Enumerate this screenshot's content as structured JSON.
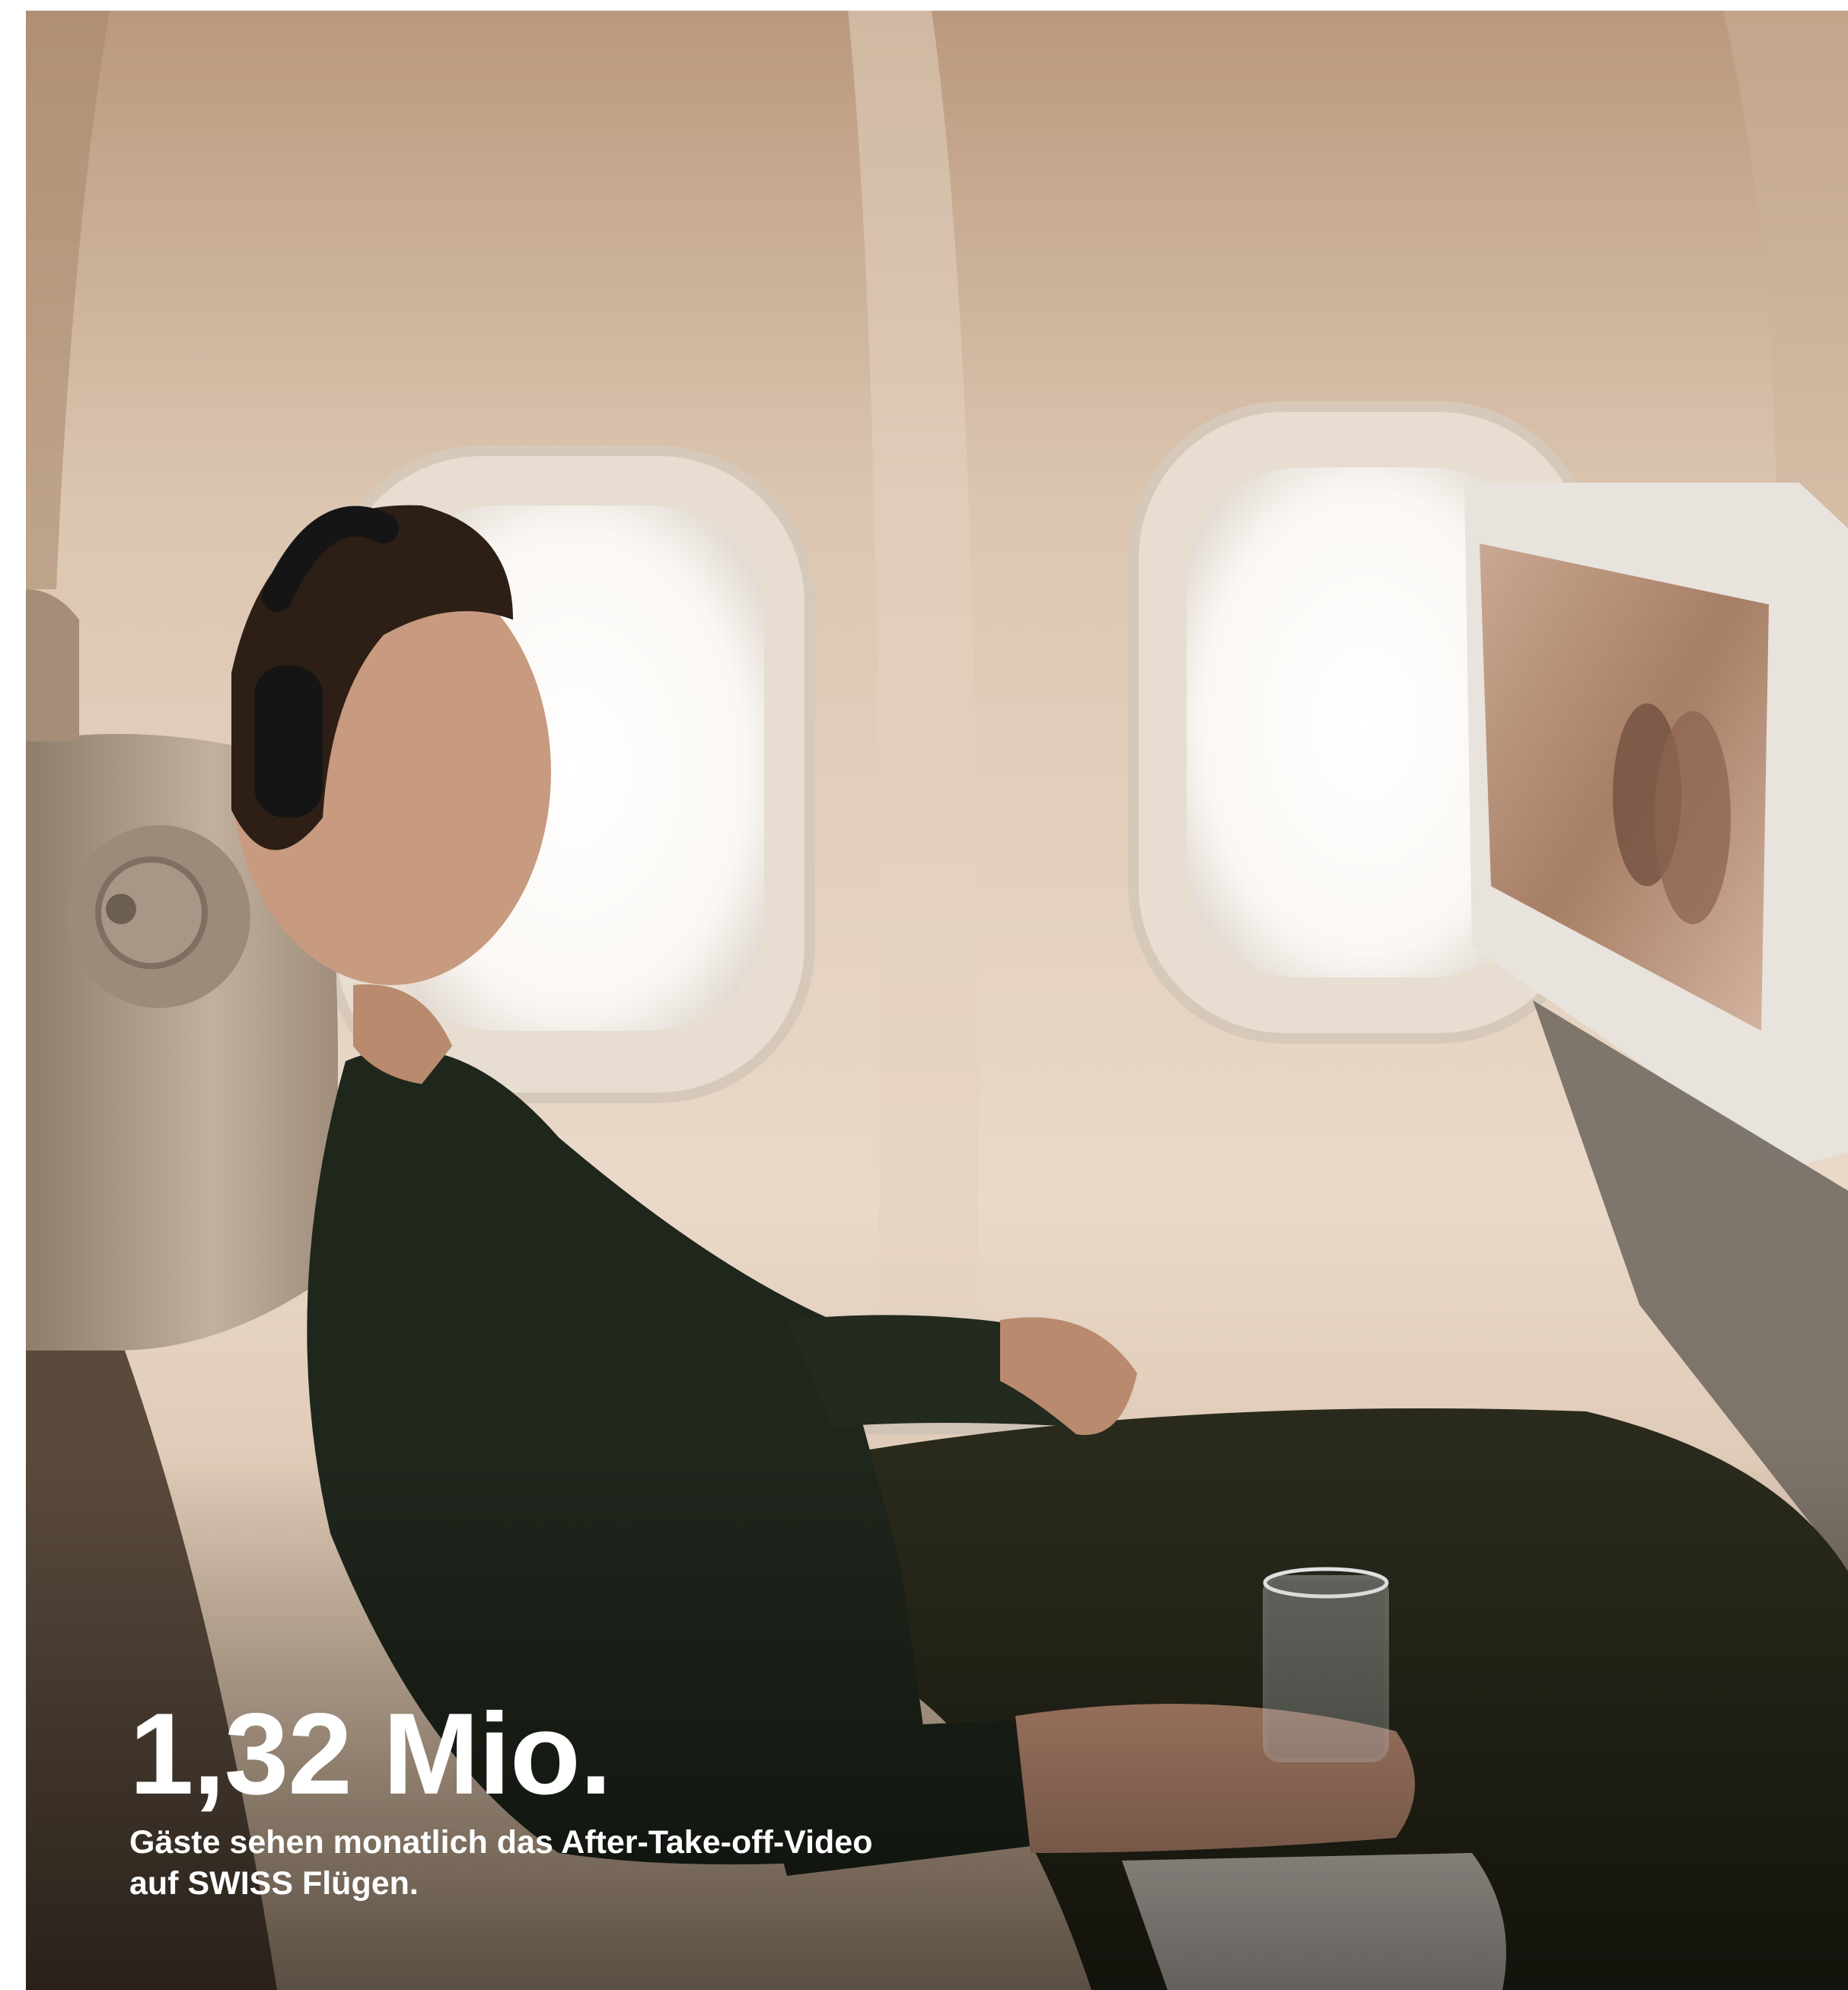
{
  "stat": {
    "value": "1,32 Mio.",
    "caption_line1": "Gäste sehen monatlich das After-Take-off-Video",
    "caption_line2": "auf SWISS Flügen."
  },
  "photo": {
    "subject": "woman-with-headphones-watching-seatback-screen",
    "colors": {
      "cabin_wall": "#e9d8c8",
      "window_light": "#ffffff",
      "sweater": "#1f261c",
      "seat": "#bfae9c",
      "shadow": "#221a13"
    }
  }
}
